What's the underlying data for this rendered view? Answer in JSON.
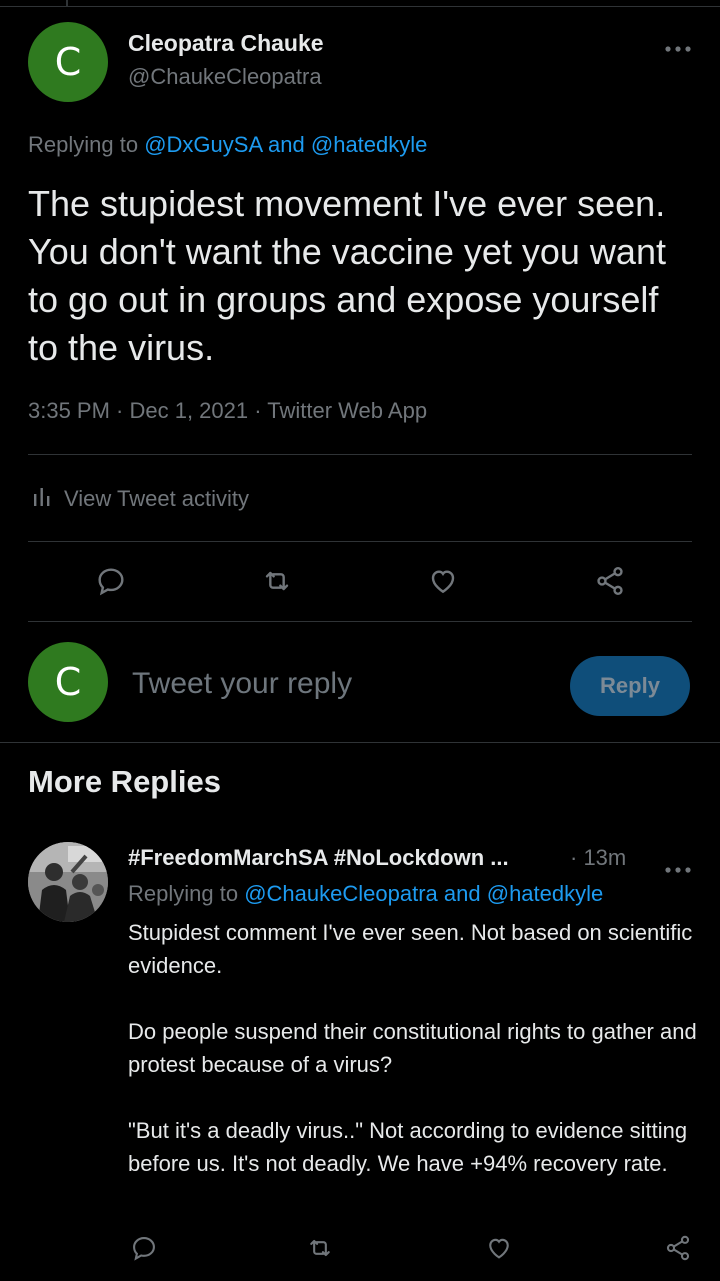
{
  "tweet": {
    "avatar_letter": "C",
    "name": "Cleopatra Chauke",
    "handle": "@ChaukeCleopatra",
    "replying_prefix": "Replying to",
    "replying_to_1": "@DxGuySA",
    "replying_and": "and",
    "replying_to_2": "@hatedkyle",
    "text": "The stupidest movement I've ever seen. You don't want the vaccine yet you want to go out in groups and expose yourself to the virus.",
    "timestamp": "3:35 PM · Dec 1, 2021 · Twitter Web App",
    "activity_label": "View Tweet activity"
  },
  "composer": {
    "avatar_letter": "C",
    "placeholder": "Tweet your reply",
    "button_label": "Reply"
  },
  "more_replies": {
    "heading": "More Replies",
    "reply": {
      "name": "#FreedomMarchSA #NoLockdown ...",
      "time": "· 13m",
      "replying_prefix": "Replying to",
      "replying_to_1": "@ChaukeCleopatra",
      "replying_and": "and",
      "replying_to_2": "@hatedkyle",
      "paragraph_1": "Stupidest comment I've ever seen. Not based on scientific evidence.",
      "paragraph_2": "Do people suspend their constitutional rights to gather and protest because of a virus?",
      "paragraph_3": "\"But it's a deadly virus..\" Not according to evidence sitting before us. It's not deadly. We have +94% recovery rate."
    }
  },
  "icons": {
    "more": "more-icon",
    "activity": "bar-chart-icon",
    "reply": "reply-icon",
    "retweet": "retweet-icon",
    "like": "heart-icon",
    "share": "share-icon"
  },
  "colors": {
    "background": "#000000",
    "accent": "#1d9bf0",
    "avatar_green": "#2f7a1f",
    "muted": "#71767b"
  }
}
